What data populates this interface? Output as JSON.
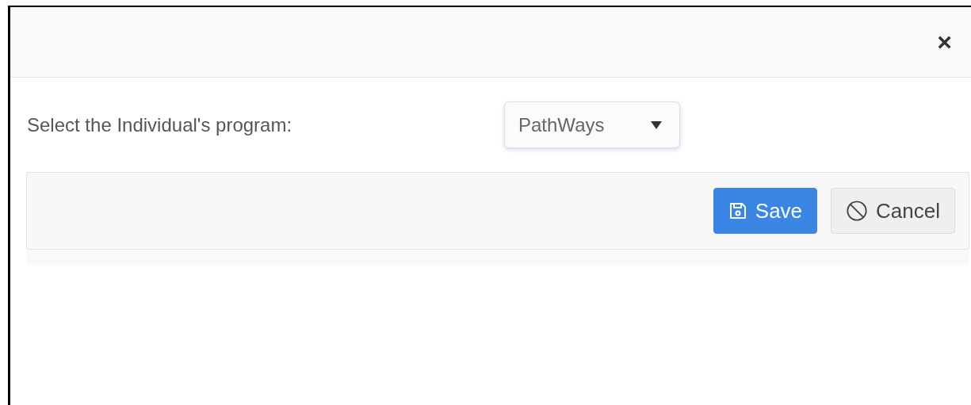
{
  "dialog": {
    "close_label": "×"
  },
  "field": {
    "label": "Select the Individual's program:",
    "value": "PathWays"
  },
  "buttons": [
    {
      "kind": "primary",
      "label": "Save"
    },
    {
      "kind": "default",
      "label": "Cancel"
    }
  ]
}
